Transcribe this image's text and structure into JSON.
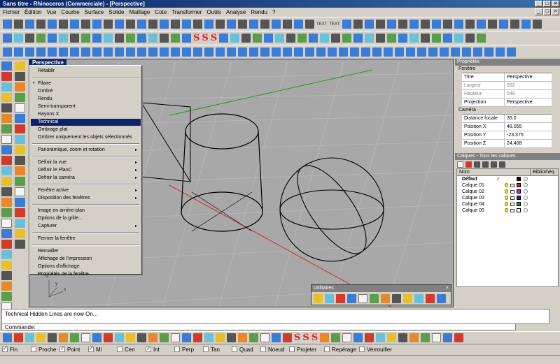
{
  "window": {
    "title": "Sans titre - Rhinoceros (Commerciale) - [Perspective]",
    "min": "_",
    "max": "□",
    "close": "×"
  },
  "menubar": [
    "Fichier",
    "Édition",
    "Vue",
    "Courbe",
    "Surface",
    "Solide",
    "Maillage",
    "Cote",
    "Transformer",
    "Outils",
    "Analyse",
    "Rendu",
    "?"
  ],
  "viewport": {
    "title": "Perspective"
  },
  "context_menu": {
    "group1": [
      "Rétablir"
    ],
    "group2": [
      "Filaire",
      "Ombré",
      "Rendu",
      "Semi-transparent",
      "Rayons X",
      "Technical",
      "Ombrage plat",
      "Ombrer uniquement les objets sélectionnés"
    ],
    "checked": "Filaire",
    "highlighted": "Technical",
    "group3": [
      "Panoramique, zoom et rotation"
    ],
    "group4": [
      "Définir la vue",
      "Définir le PlanC",
      "Définir la caméra"
    ],
    "group5": [
      "Fenêtre active",
      "Disposition des fenêtres"
    ],
    "group6": [
      "Image en arrière-plan",
      "Options de la grille...",
      "Capturer"
    ],
    "group7": [
      "Fermer la fenêtre"
    ],
    "group8": [
      "Remailler",
      "Affichage de l'impression",
      "Options d'affichage",
      "Propriétés de la fenêtre..."
    ],
    "submenu_arrow": "▸"
  },
  "properties": {
    "title": "Propriétés",
    "fenetre_label": "Fenêtre",
    "fenetre": [
      {
        "k": "Titre",
        "v": "Perspective"
      },
      {
        "k": "Largeur",
        "v": "932"
      },
      {
        "k": "Hauteur",
        "v": "548"
      },
      {
        "k": "Projection",
        "v": "Perspective"
      }
    ],
    "camera_label": "Caméra",
    "camera": [
      {
        "k": "Distance focale",
        "v": "35.0"
      },
      {
        "k": "Position X",
        "v": "48.055"
      },
      {
        "k": "Position Y",
        "v": "-23.375"
      },
      {
        "k": "Position Z",
        "v": "24.408"
      }
    ]
  },
  "layers": {
    "title": "Calques - Tous les calques",
    "col_name": "Nom",
    "col_lib": "Bibliothèq",
    "default": "Défaut",
    "check": "✓",
    "items": [
      {
        "name": "Calque 01",
        "color": "#d22020"
      },
      {
        "name": "Calque 02",
        "color": "#c21ec2"
      },
      {
        "name": "Calque 03",
        "color": "#1e1ec8"
      },
      {
        "name": "Calque 04",
        "color": "#1e961e"
      },
      {
        "name": "Calque 05",
        "color": "#ffffff"
      }
    ]
  },
  "utilitaires": {
    "title": "Utilitaires"
  },
  "command": {
    "history": "Technical Hidden Lines are now On...",
    "prompt": "Commande:"
  },
  "toolbar_text": {
    "sss": "S",
    "text1": "TEXT",
    "text2": "TEXT"
  },
  "osnap": {
    "items": [
      {
        "label": "Fin",
        "checked": true
      },
      {
        "label": "Proche",
        "checked": false
      },
      {
        "label": "Point",
        "checked": true
      },
      {
        "label": "Mi",
        "checked": true
      },
      {
        "label": "Cen",
        "checked": false
      },
      {
        "label": "Int",
        "checked": true
      },
      {
        "label": "Perp",
        "checked": false
      },
      {
        "label": "Tan",
        "checked": false
      },
      {
        "label": "Quad",
        "checked": false
      },
      {
        "label": "Noeud",
        "checked": false
      }
    ],
    "projeter": "Projeter",
    "reperage": "Repérage",
    "verrouiller": "Verrouiller"
  },
  "axis": {
    "x": "x",
    "y": "y",
    "z": "z"
  }
}
